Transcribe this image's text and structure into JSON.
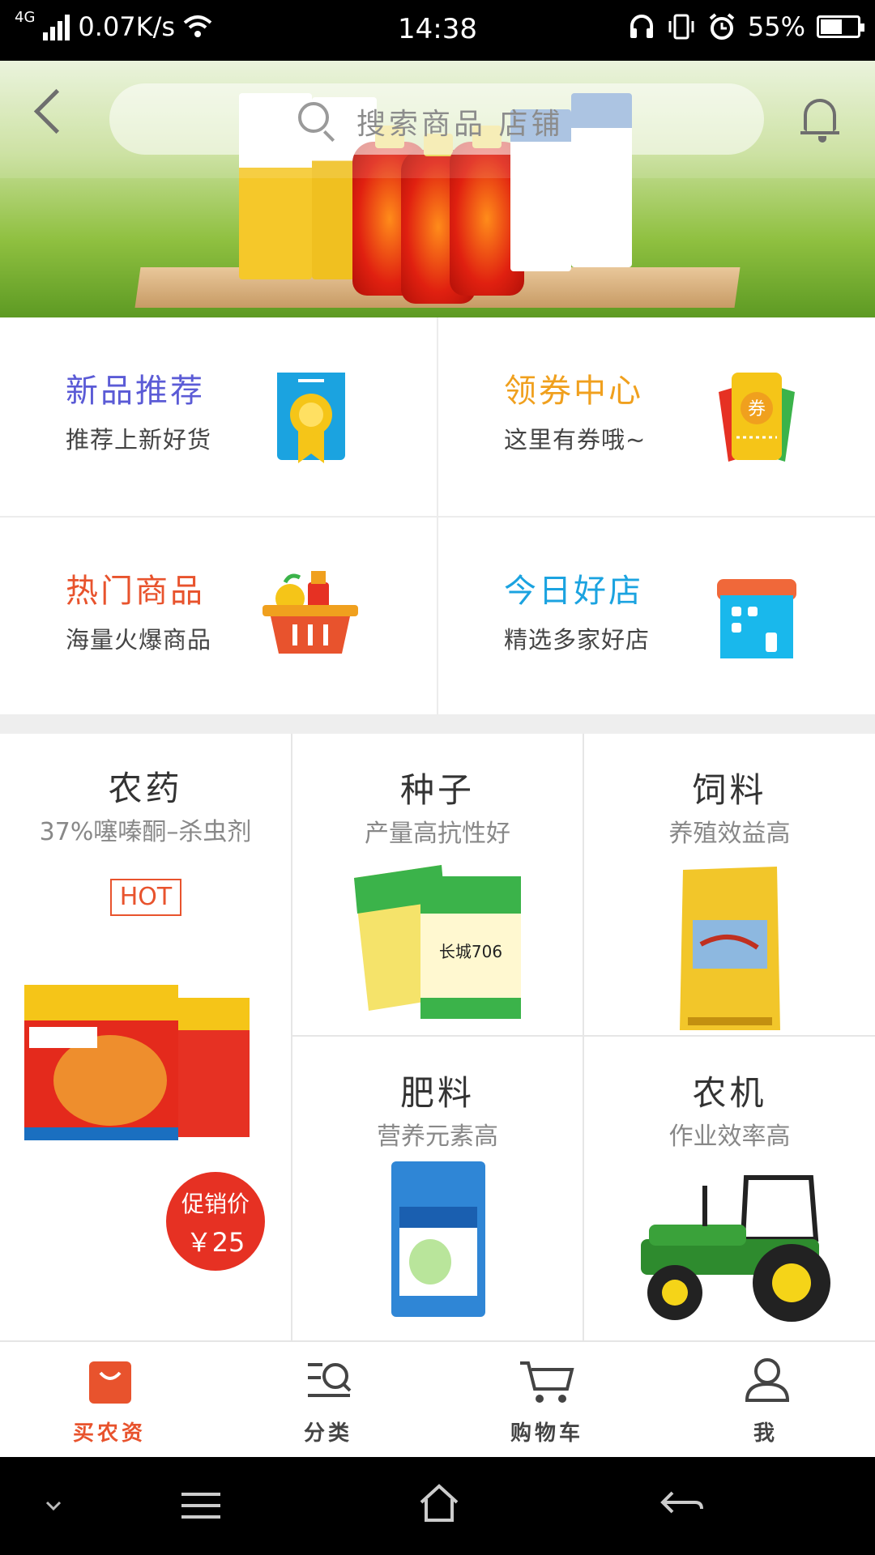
{
  "status_bar": {
    "network": "4G",
    "speed": "0.07K/s",
    "time": "14:38",
    "battery": "55%"
  },
  "search": {
    "placeholder": "搜索商品  店铺"
  },
  "features": [
    {
      "title": "新品推荐",
      "subtitle": "推荐上新好货",
      "color": "#5b5bd6"
    },
    {
      "title": "领券中心",
      "subtitle": "这里有券哦~",
      "color": "#f0a01e"
    },
    {
      "title": "热门商品",
      "subtitle": "海量火爆商品",
      "color": "#e8532d"
    },
    {
      "title": "今日好店",
      "subtitle": "精选多家好店",
      "color": "#1ba3e0"
    }
  ],
  "categories": {
    "pesticide": {
      "title": "农药",
      "subtitle": "37%噻嗪酮–杀虫剂",
      "badge": "HOT",
      "promo_label": "促销价",
      "promo_price": "￥25"
    },
    "seed": {
      "title": "种子",
      "subtitle": "产量高抗性好"
    },
    "feed": {
      "title": "饲料",
      "subtitle": "养殖效益高"
    },
    "fertilizer": {
      "title": "肥料",
      "subtitle": "营养元素高"
    },
    "machinery": {
      "title": "农机",
      "subtitle": "作业效率高"
    }
  },
  "bottom_nav": [
    {
      "label": "买农资",
      "active": true
    },
    {
      "label": "分类",
      "active": false
    },
    {
      "label": "购物车",
      "active": false
    },
    {
      "label": "我",
      "active": false
    }
  ],
  "colors": {
    "accent": "#e8532d",
    "inactive": "#444444"
  }
}
